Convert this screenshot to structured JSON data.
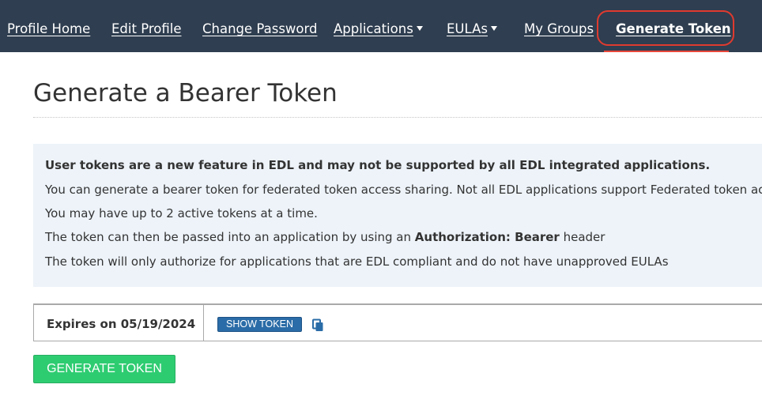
{
  "nav": {
    "items": [
      {
        "label": "Profile Home"
      },
      {
        "label": "Edit Profile"
      },
      {
        "label": "Change Password"
      },
      {
        "label": "Applications"
      },
      {
        "label": "EULAs"
      },
      {
        "label": "My Groups"
      },
      {
        "label": "Generate Token"
      }
    ],
    "active": "Generate Token"
  },
  "page": {
    "title": "Generate a Bearer Token"
  },
  "info": {
    "warning": "User tokens are a new feature in EDL and may not be supported by all EDL integrated applications.",
    "line1": "You can generate a bearer token for federated token access sharing. Not all EDL applications support Federated token acc",
    "line2": "You may have up to 2 active tokens at a time.",
    "line3_prefix": "The token can then be passed into an application by using an",
    "line3_bold": "Authorization: Bearer",
    "line3_suffix": "header",
    "line4": "The token will only authorize for applications that are EDL compliant and do not have unapproved EULAs"
  },
  "tokens": [
    {
      "expires": "Expires on 05/19/2024",
      "show_label": "SHOW TOKEN",
      "copy_icon": "copy-icon"
    }
  ],
  "actions": {
    "generate_label": "GENERATE TOKEN"
  },
  "colors": {
    "navbar": "#2f3e50",
    "highlight": "#e03a2f",
    "info_bg": "#edf3f9",
    "show_token": "#2a6ca7",
    "generate": "#2ecc71"
  }
}
